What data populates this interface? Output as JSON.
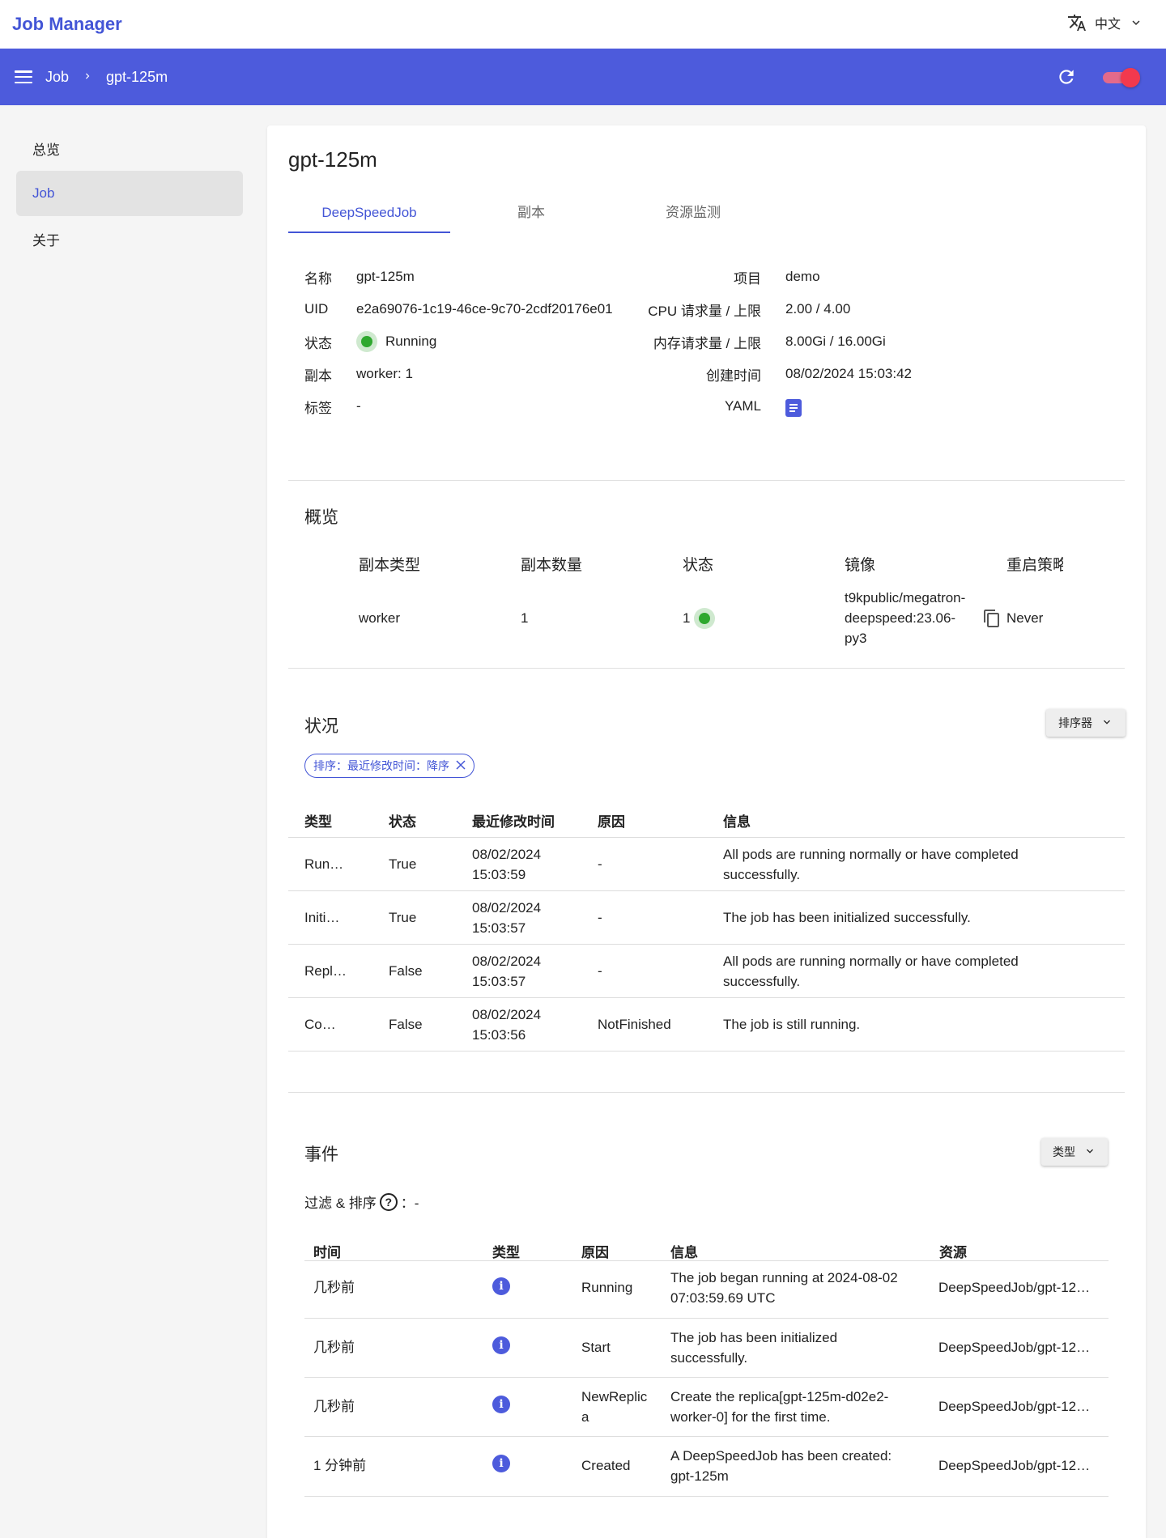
{
  "app": {
    "title": "Job Manager",
    "language": "中文"
  },
  "nav": {
    "breadcrumbs": [
      "Job",
      "gpt-125m"
    ]
  },
  "sidebar": {
    "items": [
      {
        "label": "总览"
      },
      {
        "label": "Job"
      },
      {
        "label": "关于"
      }
    ]
  },
  "job": {
    "title": "gpt-125m",
    "tabs": [
      "DeepSpeedJob",
      "副本",
      "资源监测"
    ],
    "left": [
      {
        "k": "名称",
        "v": "gpt-125m"
      },
      {
        "k": "UID",
        "v": "e2a69076-1c19-46ce-9c70-2cdf20176e01"
      },
      {
        "k": "状态",
        "v": "Running"
      },
      {
        "k": "副本",
        "v": "worker: 1"
      },
      {
        "k": "标签",
        "v": "-"
      }
    ],
    "right": [
      {
        "k": "项目",
        "v": "demo"
      },
      {
        "k": "CPU 请求量 / 上限",
        "v": "2.00 / 4.00"
      },
      {
        "k": "内存请求量 / 上限",
        "v": "8.00Gi / 16.00Gi"
      },
      {
        "k": "创建时间",
        "v": "08/02/2024 15:03:42"
      },
      {
        "k": "YAML",
        "v": ""
      }
    ]
  },
  "overview": {
    "title": "概览",
    "headers": [
      "副本类型",
      "副本数量",
      "状态",
      "镜像",
      "重启策略"
    ],
    "row": {
      "type": "worker",
      "count": "1",
      "status": "1",
      "image_lines": [
        "t9kpublic/megatron-",
        "deepspeed:23.06-",
        "py3"
      ],
      "restart": "Never"
    }
  },
  "conditions": {
    "title": "状况",
    "sort_button": "排序器",
    "chip": "排序：最近修改时间：降序",
    "headers": [
      "类型",
      "状态",
      "最近修改时间",
      "原因",
      "信息"
    ],
    "rows": [
      {
        "type": "Run…",
        "status": "True",
        "time1": "08/02/2024",
        "time2": "15:03:59",
        "reason": "-",
        "msg1": "All pods are running normally or have completed",
        "msg2": "successfully."
      },
      {
        "type": "Initi…",
        "status": "True",
        "time1": "08/02/2024",
        "time2": "15:03:57",
        "reason": "-",
        "msg1": "The job has been initialized successfully.",
        "msg2": ""
      },
      {
        "type": "Repl…",
        "status": "False",
        "time1": "08/02/2024",
        "time2": "15:03:57",
        "reason": "-",
        "msg1": "All pods are running normally or have completed",
        "msg2": "successfully."
      },
      {
        "type": "Co…",
        "status": "False",
        "time1": "08/02/2024",
        "time2": "15:03:56",
        "reason": "NotFinished",
        "msg1": "The job is still running.",
        "msg2": ""
      }
    ]
  },
  "events": {
    "title": "事件",
    "type_button": "类型",
    "filter_label": "过滤 & 排序",
    "filter_value": "：-",
    "headers": [
      "时间",
      "类型",
      "原因",
      "信息",
      "资源"
    ],
    "rows": [
      {
        "time": "几秒前",
        "reason1": "Running",
        "reason2": "",
        "msg1": "The job began running at 2024-08-02",
        "msg2": "07:03:59.69 UTC",
        "resource": "DeepSpeedJob/gpt-12…"
      },
      {
        "time": "几秒前",
        "reason1": "Start",
        "reason2": "",
        "msg1": "The job has been initialized",
        "msg2": "successfully.",
        "resource": "DeepSpeedJob/gpt-12…"
      },
      {
        "time": "几秒前",
        "reason1": "NewReplic",
        "reason2": "a",
        "msg1": "Create the replica[gpt-125m-d02e2-",
        "msg2": "worker-0] for the first time.",
        "resource": "DeepSpeedJob/gpt-12…"
      },
      {
        "time": "1 分钟前",
        "reason1": "Created",
        "reason2": "",
        "msg1": "A DeepSpeedJob has been created:",
        "msg2": "gpt-125m",
        "resource": "DeepSpeedJob/gpt-12…"
      }
    ]
  },
  "colors": {
    "primary": "#4d5bdc",
    "link": "#4355d6",
    "running": "#2fa82f",
    "toggle": "#f2394e"
  },
  "icons": [
    "menu-icon",
    "chevron-right-icon",
    "translate-icon",
    "chevron-down-icon",
    "refresh-icon",
    "yaml-doc-icon",
    "copy-icon",
    "close-icon",
    "help-icon",
    "info-icon"
  ]
}
